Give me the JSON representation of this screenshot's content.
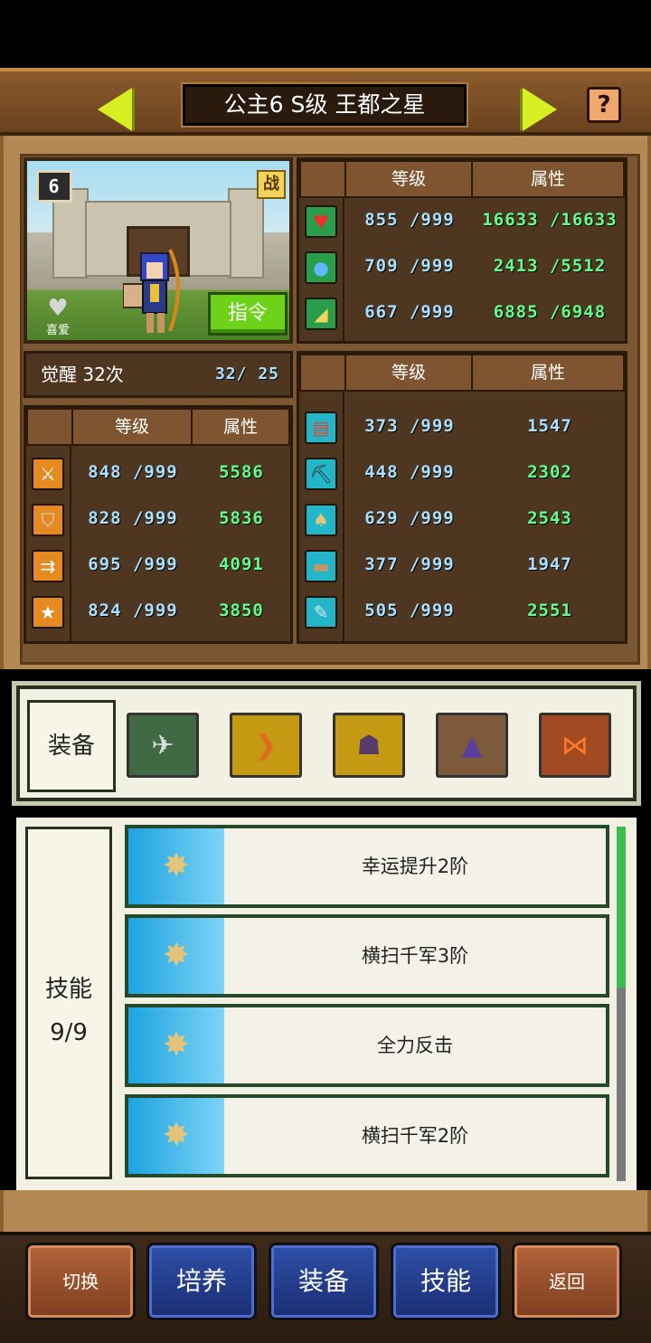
{
  "header": {
    "title": "公主6 S级 王都之星",
    "help_label": "?"
  },
  "portrait": {
    "level_badge": "6",
    "battle_badge": "战",
    "favorite_label": "喜爱",
    "order_button": "指令"
  },
  "table_headers": {
    "level": "等级",
    "attribute": "属性"
  },
  "vitals": [
    {
      "icon": "heart-icon",
      "level": "855 /999",
      "attr": "16633 /16633"
    },
    {
      "icon": "potion-icon",
      "level": "709 /999",
      "attr": "2413 /5512"
    },
    {
      "icon": "stamina-icon",
      "level": "667 /999",
      "attr": "6885 /6948"
    }
  ],
  "awaken": {
    "label": "觉醒 32次",
    "count": "32/ 25"
  },
  "combat_stats": [
    {
      "icon": "sword-icon",
      "level": "848 /999",
      "attr": "5586"
    },
    {
      "icon": "shield-icon",
      "level": "828 /999",
      "attr": "5836"
    },
    {
      "icon": "speed-icon",
      "level": "695 /999",
      "attr": "4091"
    },
    {
      "icon": "star-icon",
      "level": "824 /999",
      "attr": "3850"
    }
  ],
  "work_stats": [
    {
      "icon": "book-icon",
      "level": "373 /999",
      "attr": "1547"
    },
    {
      "icon": "pickaxe-icon",
      "level": "448 /999",
      "attr": "2302"
    },
    {
      "icon": "shovel-icon",
      "level": "629 /999",
      "attr": "2543"
    },
    {
      "icon": "anvil-icon",
      "level": "377 /999",
      "attr": "1947"
    },
    {
      "icon": "tool-icon",
      "level": "505 /999",
      "attr": "2551"
    }
  ],
  "equipment": {
    "label": "装备",
    "slots": [
      {
        "name": "wing-item-icon",
        "bg": "#3f6a44"
      },
      {
        "name": "bow-item-icon",
        "bg": "#c49a12"
      },
      {
        "name": "cat-mask-item-icon",
        "bg": "#c49a12"
      },
      {
        "name": "hood-item-icon",
        "bg": "#7e5a3c"
      },
      {
        "name": "ribbon-item-icon",
        "bg": "#a24a22"
      }
    ]
  },
  "skills": {
    "label": "技能",
    "count": "9/9",
    "items": [
      {
        "name": "幸运提升2阶"
      },
      {
        "name": "横扫千军3阶"
      },
      {
        "name": "全力反击"
      },
      {
        "name": "横扫千军2阶"
      }
    ]
  },
  "bottom_nav": {
    "switch": "切换",
    "train": "培养",
    "equip": "装备",
    "skill": "技能",
    "back": "返回"
  }
}
